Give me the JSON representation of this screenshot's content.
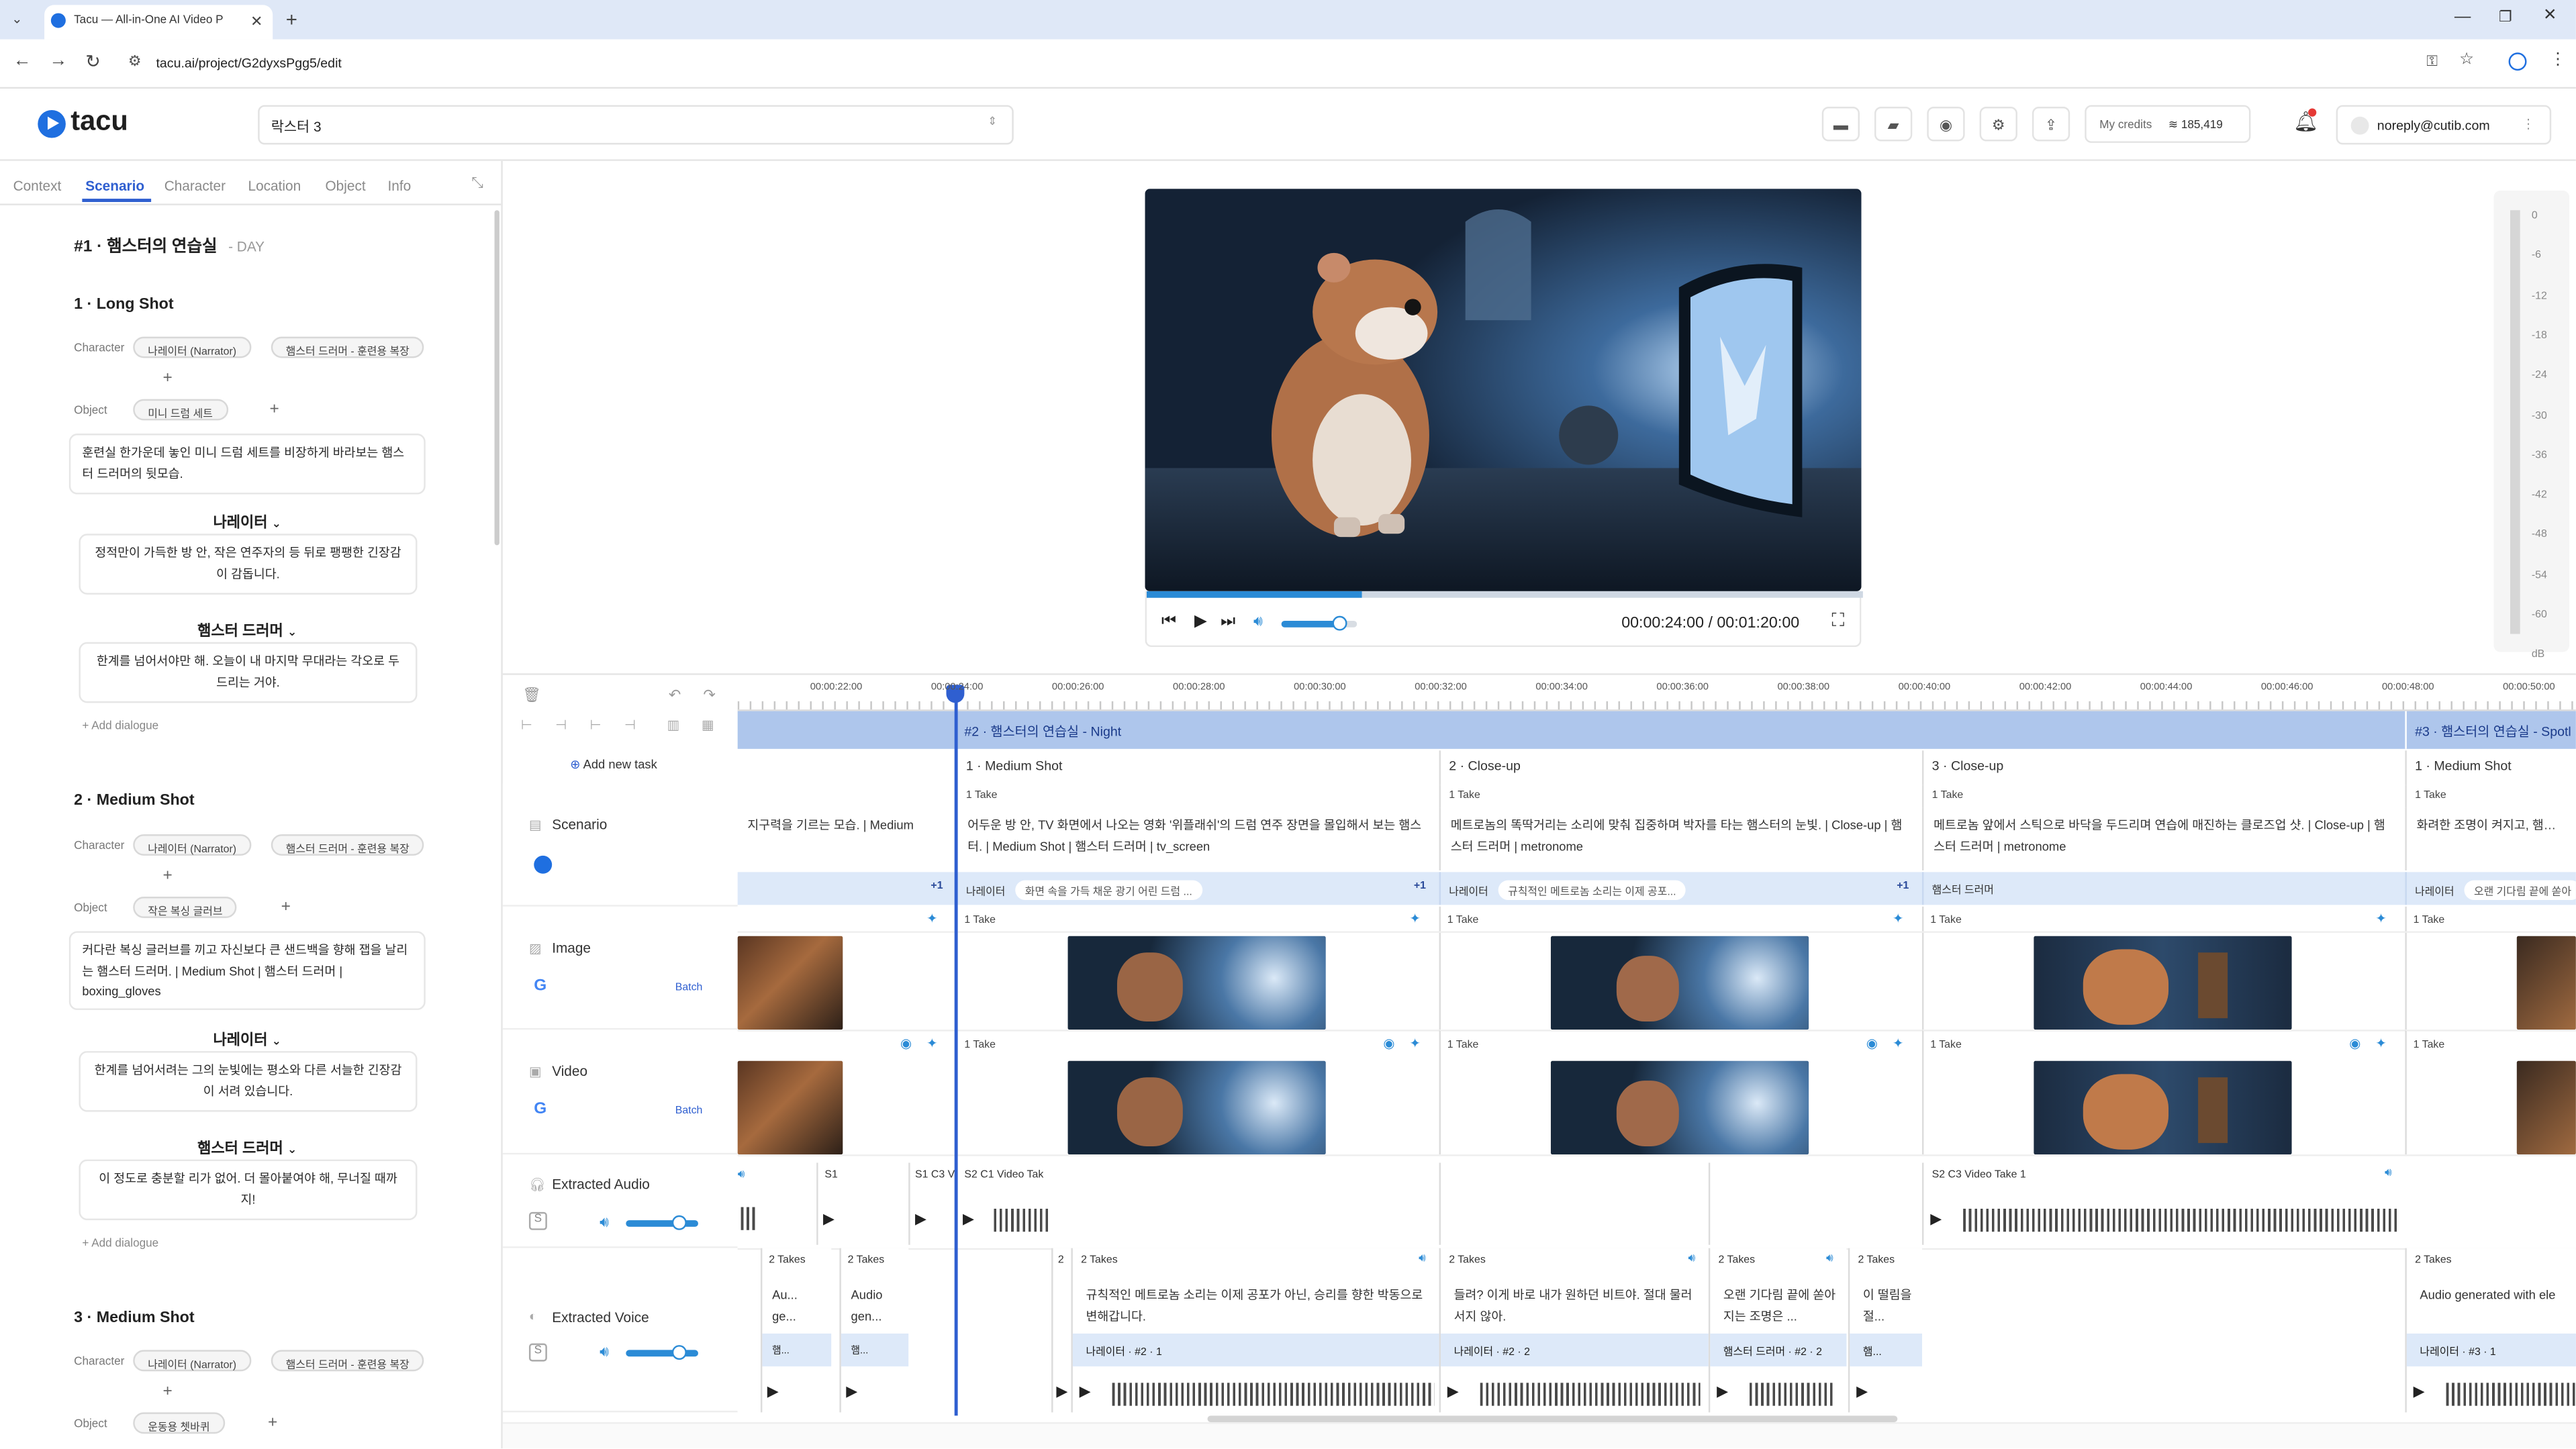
{
  "browser": {
    "tab_title": "Tacu — All-in-One AI Video P",
    "url": "tacu.ai/project/G2dyxsPgg5/edit"
  },
  "header": {
    "logo_text": "tacu",
    "project_name": "락스터 3",
    "credits_label": "My credits",
    "credits_value": "185,419",
    "user_email": "noreply@cutib.com"
  },
  "left_tabs": [
    "Context",
    "Scenario",
    "Character",
    "Location",
    "Object",
    "Info"
  ],
  "scene_title": "#1 · 햄스터의 연습실",
  "scene_time": "- DAY",
  "shots": [
    {
      "name": "1 · Long Shot",
      "character_label": "Character",
      "characters": [
        "나레이터 (Narrator)",
        "햄스터 드러머 - 훈련용 복장"
      ],
      "object_label": "Object",
      "objects": [
        "미니 드럼 세트"
      ],
      "description": "훈련실 한가운데 놓인 미니 드럼 세트를 비장하게 바라보는 햄스터 드러머의 뒷모습.",
      "dialogues": [
        {
          "speaker": "나레이터",
          "text": "정적만이 가득한 방 안, 작은 연주자의 등 뒤로 팽팽한 긴장감이 감돕니다."
        },
        {
          "speaker": "햄스터 드러머",
          "text": "한계를 넘어서야만 해. 오늘이 내 마지막 무대라는 각오로 두드리는 거야."
        }
      ],
      "add_dialogue": "Add dialogue"
    },
    {
      "name": "2 · Medium Shot",
      "character_label": "Character",
      "characters": [
        "나레이터 (Narrator)",
        "햄스터 드러머 - 훈련용 복장"
      ],
      "object_label": "Object",
      "objects": [
        "작은 복싱 글러브"
      ],
      "description": "커다란 복싱 글러브를 끼고 자신보다 큰 샌드백을 향해 잽을 날리는 햄스터 드러머. | Medium Shot | 햄스터 드러머 | boxing_gloves",
      "dialogues": [
        {
          "speaker": "나레이터",
          "text": "한계를 넘어서려는 그의 눈빛에는 평소와 다른 서늘한 긴장감이 서려 있습니다."
        },
        {
          "speaker": "햄스터 드러머",
          "text": "이 정도로 충분할 리가 없어. 더 몰아붙여야 해, 무너질 때까지!"
        }
      ],
      "add_dialogue": "Add dialogue"
    },
    {
      "name": "3 · Medium Shot",
      "character_label": "Character",
      "characters": [
        "나레이터 (Narrator)",
        "햄스터 드러머 - 훈련용 복장"
      ],
      "object_label": "Object",
      "objects": [
        "운동용 쳇바퀴"
      ]
    }
  ],
  "player": {
    "time": "00:00:24:00 / 00:01:20:00",
    "progress": 0.3,
    "volume": 0.75
  },
  "meter_ticks": [
    "0",
    "-6",
    "-12",
    "-18",
    "-24",
    "-30",
    "-36",
    "-42",
    "-48",
    "-54",
    "-60",
    "dB"
  ],
  "timeline": {
    "add_task": "Add new task",
    "ruler": [
      "00:00:22:00",
      "00:00:24:00",
      "00:00:26:00",
      "00:00:28:00",
      "00:00:30:00",
      "00:00:32:00",
      "00:00:34:00",
      "00:00:36:00",
      "00:00:38:00",
      "00:00:40:00",
      "00:00:42:00",
      "00:00:44:00",
      "00:00:46:00",
      "00:00:48:00",
      "00:00:50:00"
    ],
    "tracks": {
      "scenario": "Scenario",
      "image": "Image",
      "video": "Video",
      "extracted_audio": "Extracted Audio",
      "extracted_voice": "Extracted Voice",
      "batch": "Batch"
    },
    "scenes": [
      "#2 · 햄스터의 연습실 - Night",
      "#3 · 햄스터의 연습실 - Spotl"
    ],
    "one_take": "1 Take",
    "plus_one": "+1",
    "prev_desc": "지구력을 기르는 모습. | Medium",
    "shots": [
      {
        "name": "1 · Medium Shot",
        "desc": "어두운 방 안, TV 화면에서 나오는 영화 '위플래쉬'의 드럼 연주 장면을 몰입해서 보는 햄스터. | Medium Shot | 햄스터 드러머 | tv_screen",
        "dlg_speaker": "나레이터",
        "dlg_text": "화면 속을 가득 채운 광기 어린 드럼 ...",
        "voice": {
          "takes": "2 Takes",
          "text": "규칙적인 메트로놈 소리는 이제 공포가 아닌, 승리를 향한 박동으로 변해갑니다.",
          "tag": "나레이터 · #2 · 1"
        }
      },
      {
        "name": "2 · Close-up",
        "desc": "메트로놈의 똑딱거리는 소리에 맞춰 집중하며 박자를 타는 햄스터의 눈빛. | Close-up | 햄스터 드러머 | metronome",
        "dlg_speaker": "나레이터",
        "dlg_text": "규칙적인 메트로놈 소리는 이제 공포...",
        "voice": {
          "takes": "2 Takes",
          "text": "들려? 이게 바로 내가 원하던 비트야. 절대 물러서지 않아.",
          "tag": "나레이터 · #2 · 2"
        },
        "voice2": {
          "takes": "2 Takes",
          "text": "오랜 기다림 끝에 쏟아지는 조명은 ...",
          "tag": "햄스터 드러머 · #2 · 2"
        },
        "voice3": {
          "takes": "2 Takes",
          "text": "이 떨림을 절...",
          "tag": "햄..."
        }
      },
      {
        "name": "3 · Close-up",
        "desc": "메트로놈 앞에서 스틱으로 바닥을 두드리며 연습에 매진하는 클로즈업 샷. | Close-up | 햄스터 드러머 | metronome",
        "dlg_speaker": "햄스터 드러머",
        "audio_label": "S2 C3 Video Take 1"
      },
      {
        "name": "1 · Medium Shot",
        "desc": "화려한 조명이 켜지고, 햄스터",
        "dlg_speaker": "나레이터",
        "dlg_text": "오랜 기다림 끝에 쏟아",
        "voice": {
          "takes": "2 Takes",
          "text": "Audio generated with ele",
          "tag": "나레이터 · #3 · 1"
        }
      }
    ],
    "prev_audio": [
      "S1",
      "S1 C3 V"
    ],
    "prev_audio2": "S2 C1 Video Tak",
    "prev_voice": [
      {
        "takes": "2 Takes",
        "text": "Au... ge...",
        "tag": "햄..."
      },
      {
        "takes": "2 Takes",
        "text": "Audio gen...",
        "tag": "햄..."
      }
    ],
    "col2_takes": "2"
  }
}
